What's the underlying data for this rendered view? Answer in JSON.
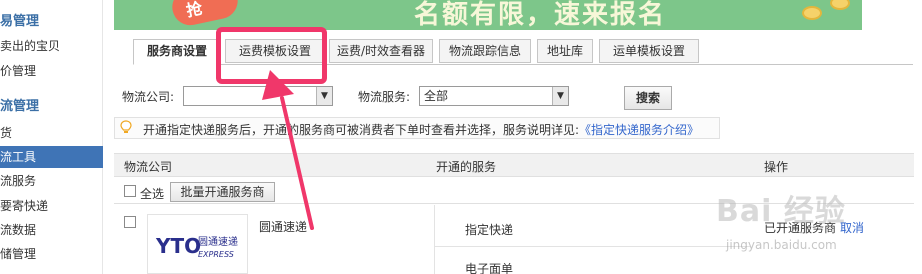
{
  "sidebar": {
    "items": [
      {
        "label": "易管理",
        "kind": "section"
      },
      {
        "label": "卖出的宝贝",
        "kind": "item"
      },
      {
        "label": "价管理",
        "kind": "item"
      },
      {
        "label": "流管理",
        "kind": "section"
      },
      {
        "label": "货",
        "kind": "item"
      },
      {
        "label": "流工具",
        "kind": "active"
      },
      {
        "label": "流服务",
        "kind": "item"
      },
      {
        "label": "要寄快递",
        "kind": "item"
      },
      {
        "label": "流数据",
        "kind": "item"
      },
      {
        "label": "储管理",
        "kind": "item"
      }
    ]
  },
  "banner": {
    "badge_text": "抢",
    "promo_text": "名额有限，速来报名"
  },
  "tabs": [
    {
      "label": "服务商设置",
      "active": true
    },
    {
      "label": "运费模板设置",
      "active": false
    },
    {
      "label": "运费/时效查看器",
      "active": false
    },
    {
      "label": "物流跟踪信息",
      "active": false
    },
    {
      "label": "地址库",
      "active": false
    },
    {
      "label": "运单模板设置",
      "active": false
    }
  ],
  "filters": {
    "company_label": "物流公司:",
    "company_value": "",
    "service_label": "物流服务:",
    "service_value": "全部",
    "search_label": "搜索"
  },
  "tip": {
    "text": "开通指定快递服务后，开通的服务商可被消费者下单时查看并选择，服务说明详见:",
    "link": "《指定快递服务介绍》"
  },
  "table": {
    "headers": {
      "company": "物流公司",
      "service": "开通的服务",
      "action": "操作"
    },
    "select_all": "全选",
    "batch_button": "批量开通服务商",
    "rows": [
      {
        "company": "圆通速递",
        "logo_letters": "YTO",
        "logo_cn": "圆通速递",
        "logo_en": "EXPRESS",
        "services": [
          "指定快递",
          "电子面单"
        ],
        "status": "已开通服务商",
        "action": "取消"
      }
    ]
  },
  "watermark": {
    "brand": "Bai 经验",
    "url": "jingyan.baidu.com"
  },
  "colors": {
    "highlight": "#f0376a",
    "link": "#3366cc",
    "banner": "#7dc68a",
    "sidebar_active": "#3f74b6"
  }
}
